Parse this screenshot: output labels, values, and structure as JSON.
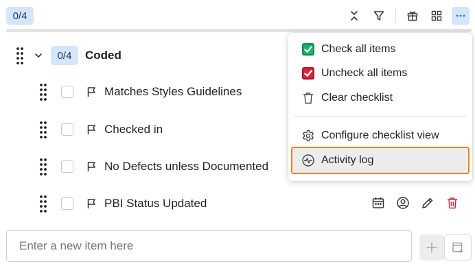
{
  "toolbar": {
    "count_badge": "0/4",
    "icons": [
      "collapse-icon",
      "filter-icon",
      "gift-icon",
      "grid-icon",
      "more-icon"
    ]
  },
  "group": {
    "count_badge": "0/4",
    "title": "Coded"
  },
  "items": [
    {
      "label": "Matches Styles Guidelines"
    },
    {
      "label": "Checked in"
    },
    {
      "label": "No Defects unless Documented"
    },
    {
      "label": "PBI Status Updated"
    }
  ],
  "new_item": {
    "placeholder": "Enter a new item here",
    "value": ""
  },
  "menu": {
    "check_all": "Check all items",
    "uncheck_all": "Uncheck all items",
    "clear": "Clear checklist",
    "configure": "Configure checklist view",
    "activity_log": "Activity log"
  },
  "colors": {
    "accent": "#d3e6fb",
    "check_green": "#19b368",
    "uncheck_red": "#d7263d",
    "highlight_outline": "#ee7f1f"
  }
}
